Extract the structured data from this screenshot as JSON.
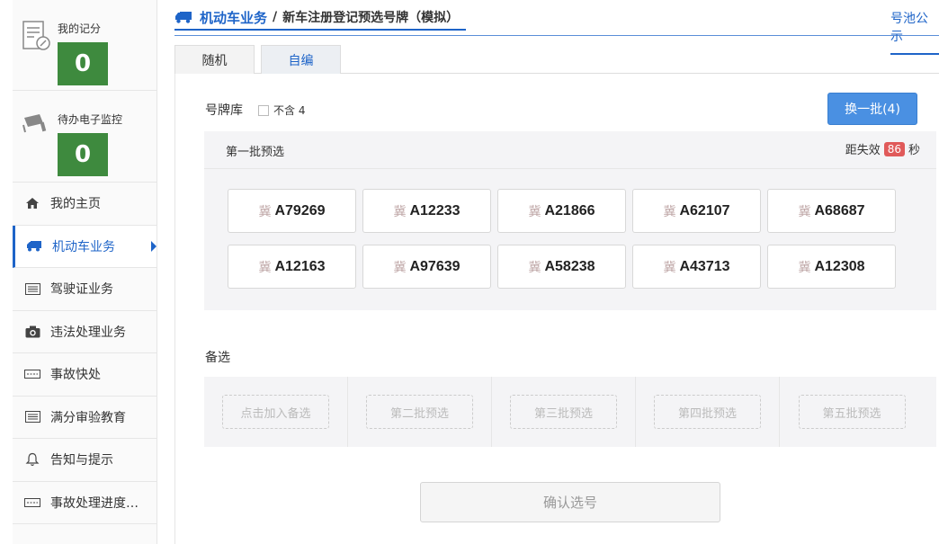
{
  "sidebar": {
    "stats": [
      {
        "label": "我的记分",
        "count": "0",
        "icon": "score-icon"
      },
      {
        "label": "待办电子监控",
        "count": "0",
        "icon": "camera-monitor-icon"
      }
    ],
    "items": [
      {
        "label": "我的主页",
        "icon": "home-icon"
      },
      {
        "label": "机动车业务",
        "icon": "truck-icon"
      },
      {
        "label": "驾驶证业务",
        "icon": "license-icon"
      },
      {
        "label": "违法处理业务",
        "icon": "camera-icon"
      },
      {
        "label": "事故快处",
        "icon": "ticket-icon"
      },
      {
        "label": "满分审验教育",
        "icon": "list-icon"
      },
      {
        "label": "告知与提示",
        "icon": "bell-icon"
      },
      {
        "label": "事故处理进度…",
        "icon": "ticket-icon"
      }
    ],
    "active_index": 1
  },
  "header": {
    "breadcrumb_home": "机动车业务",
    "separator": "/",
    "breadcrumb_current": "新车注册登记预选号牌（模拟）",
    "right_link": "号池公示"
  },
  "tabs": [
    {
      "label": "随机",
      "active": true
    },
    {
      "label": "自编",
      "active": false
    }
  ],
  "pool": {
    "label": "号牌库",
    "exclude_label": "不含 4",
    "refresh_label": "换一批(4)"
  },
  "batch": {
    "title": "第一批预选",
    "expire_prefix": "距失效",
    "expire_seconds": "86",
    "expire_suffix": "秒",
    "plates": [
      {
        "prov": "冀",
        "num": "A79269"
      },
      {
        "prov": "冀",
        "num": "A12233"
      },
      {
        "prov": "冀",
        "num": "A21866"
      },
      {
        "prov": "冀",
        "num": "A62107"
      },
      {
        "prov": "冀",
        "num": "A68687"
      },
      {
        "prov": "冀",
        "num": "A12163"
      },
      {
        "prov": "冀",
        "num": "A97639"
      },
      {
        "prov": "冀",
        "num": "A58238"
      },
      {
        "prov": "冀",
        "num": "A43713"
      },
      {
        "prov": "冀",
        "num": "A12308"
      }
    ]
  },
  "alternates": {
    "label": "备选",
    "slots": [
      "点击加入备选",
      "第二批预选",
      "第三批预选",
      "第四批预选",
      "第五批预选"
    ]
  },
  "confirm_label": "确认选号",
  "colors": {
    "accent": "#1e64c8",
    "count_bg": "#3e8a3e",
    "refresh_bg": "#4a90e2",
    "timer_bg": "#e05a5a"
  }
}
